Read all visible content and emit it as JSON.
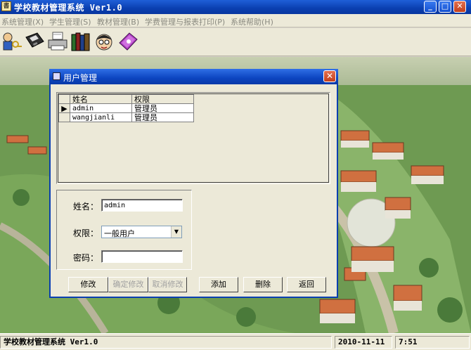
{
  "window": {
    "title": "学校教材管理系统  Ver1.0",
    "app_icon": "app-icon"
  },
  "menu": [
    "系统管理(X)",
    "学生管理(S)",
    "教材管理(B)",
    "学费管理与报表打印(P)",
    "系统帮助(H)"
  ],
  "toolbar": [
    {
      "name": "user-keys-icon"
    },
    {
      "name": "floppy-disk-icon"
    },
    {
      "name": "printer-icon"
    },
    {
      "name": "books-icon"
    },
    {
      "name": "student-face-icon"
    },
    {
      "name": "book-purple-icon"
    }
  ],
  "dialog": {
    "title": "用户管理",
    "grid": {
      "columns": [
        "姓名",
        "权限"
      ],
      "rows": [
        {
          "name": "admin",
          "role": "管理员",
          "current": true
        },
        {
          "name": "wangjianli",
          "role": "管理员",
          "current": false
        }
      ]
    },
    "form": {
      "name_label": "姓名：",
      "name_value": "admin",
      "role_label": "权限：",
      "role_value": "一般用户",
      "password_label": "密码：",
      "password_value": ""
    },
    "buttons": {
      "modify": "修改",
      "confirm": "确定修改",
      "cancel": "取消修改",
      "add": "添加",
      "delete": "删除",
      "back": "返回"
    }
  },
  "status": {
    "app": "学校教材管理系统 Ver1.0",
    "date": "2010-11-11",
    "time": "7:51"
  }
}
